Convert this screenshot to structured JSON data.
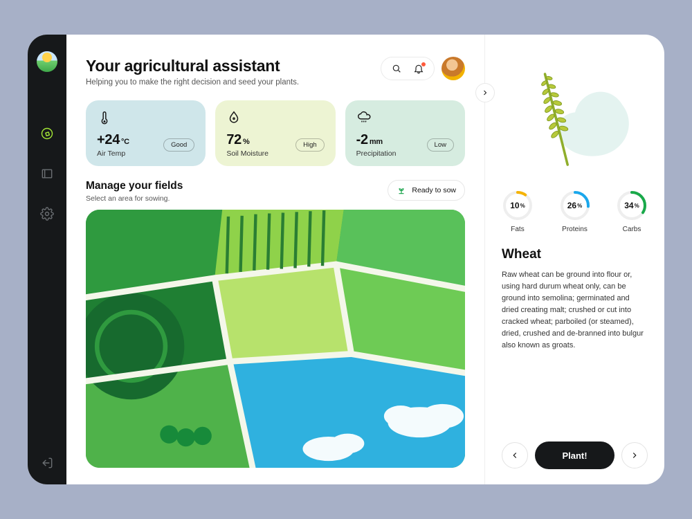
{
  "header": {
    "title": "Your agricultural assistant",
    "subtitle": "Helping you to make the right decision and seed your plants."
  },
  "metrics": {
    "temp": {
      "value": "+24",
      "unit": "°C",
      "label": "Air Temp",
      "badge": "Good"
    },
    "moist": {
      "value": "72",
      "unit": "%",
      "label": "Soil Moisture",
      "badge": "High"
    },
    "precip": {
      "value": "-2",
      "unit": "mm",
      "label": "Precipitation",
      "badge": "Low"
    }
  },
  "fields": {
    "title": "Manage your fields",
    "subtitle": "Select an area for sowing.",
    "status": "Ready to sow"
  },
  "plant": {
    "name": "Wheat",
    "description": "Raw wheat can be ground into flour or, using hard durum wheat only, can be ground into semolina; germinated and dried creating malt; crushed or cut into cracked wheat; parboiled (or steamed), dried, crushed and de-branned into bulgur also known as groats.",
    "nutrients": {
      "fats": {
        "value": "10",
        "label": "Fats"
      },
      "proteins": {
        "value": "26",
        "label": "Proteins"
      },
      "carbs": {
        "value": "34",
        "label": "Carbs"
      }
    },
    "cta": "Plant!"
  },
  "colors": {
    "ring_fats": "#f5b301",
    "ring_proteins": "#1aa7ec",
    "ring_carbs": "#19a94a"
  },
  "percent_sign": "%"
}
